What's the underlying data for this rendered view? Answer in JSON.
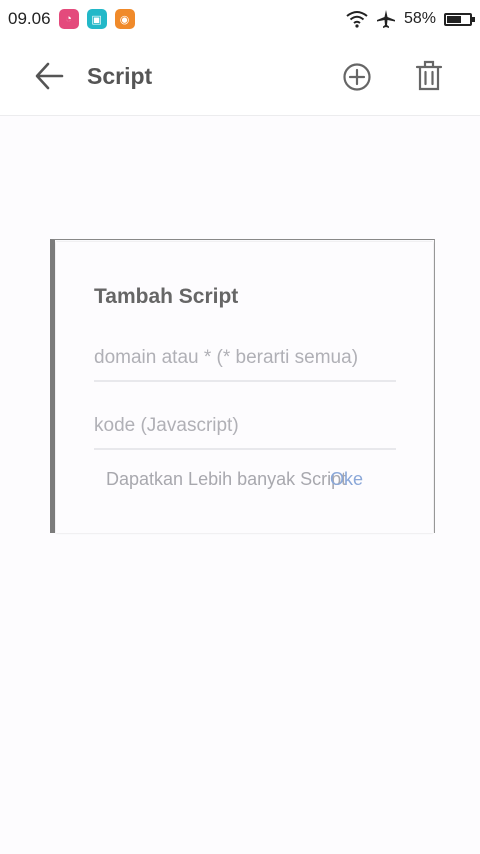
{
  "status_bar": {
    "time": "09.06",
    "battery": "58%",
    "battery_level": 0.58
  },
  "app_bar": {
    "title": "Script",
    "back_icon": "arrow-left-icon",
    "add_icon": "plus-circle-icon",
    "delete_icon": "trash-icon"
  },
  "dialog": {
    "title": "Tambah Script",
    "domain_placeholder": "domain atau * (* berarti semua)",
    "code_placeholder": "kode (Javascript)",
    "more_link": "Dapatkan Lebih banyak Script",
    "ok_label": "Oke"
  },
  "colors": {
    "accent": "#8aa7d8",
    "title": "#555555"
  }
}
